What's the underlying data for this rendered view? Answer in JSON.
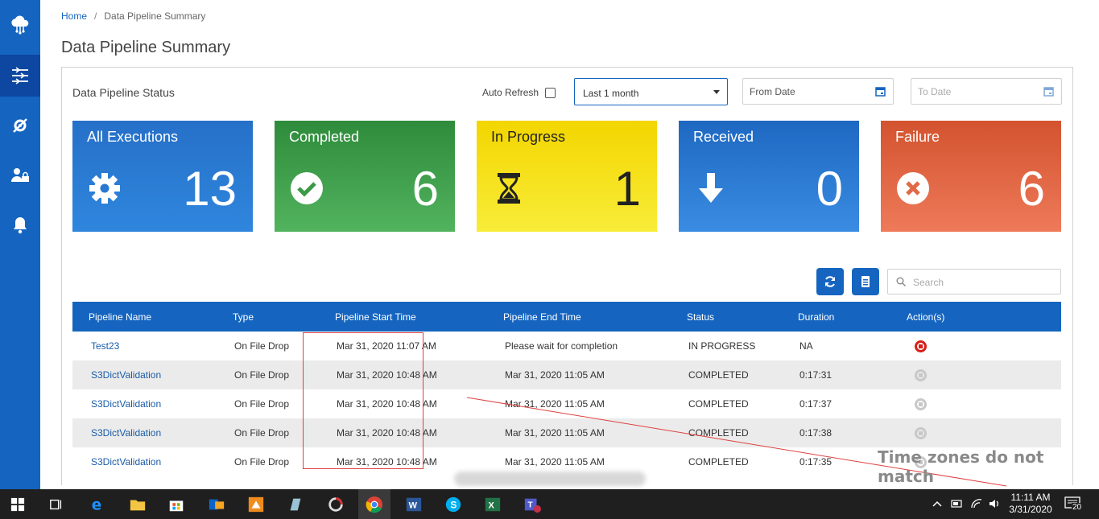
{
  "breadcrumb": {
    "home": "Home",
    "separator": "/",
    "current": "Data Pipeline Summary"
  },
  "page_title": "Data Pipeline Summary",
  "panel": {
    "title": "Data Pipeline Status",
    "auto_refresh_label": "Auto Refresh",
    "auto_refresh_checked": false,
    "range_selected": "Last 1 month",
    "from_date_placeholder": "From Date",
    "to_date_placeholder": "To Date"
  },
  "cards": {
    "all": {
      "label": "All Executions",
      "value": "13",
      "icon": "gear-icon"
    },
    "completed": {
      "label": "Completed",
      "value": "6",
      "icon": "check-circle-icon"
    },
    "in_progress": {
      "label": "In Progress",
      "value": "1",
      "icon": "hourglass-icon"
    },
    "received": {
      "label": "Received",
      "value": "0",
      "icon": "arrow-down-icon"
    },
    "failure": {
      "label": "Failure",
      "value": "6",
      "icon": "x-circle-icon"
    }
  },
  "search_placeholder": "Search",
  "table": {
    "headers": [
      "Pipeline Name",
      "Type",
      "Pipeline Start Time",
      "Pipeline End Time",
      "Status",
      "Duration",
      "Action(s)"
    ],
    "rows": [
      {
        "name": "Test23",
        "type": "On File Drop",
        "start": "Mar 31, 2020 11:07 AM",
        "end": "Please wait for completion",
        "status": "IN PROGRESS",
        "duration": "NA",
        "action": "stop"
      },
      {
        "name": "S3DictValidation",
        "type": "On File Drop",
        "start": "Mar 31, 2020 10:48 AM",
        "end": "Mar 31, 2020 11:05 AM",
        "status": "COMPLETED",
        "duration": "0:17:31",
        "action": "disabled"
      },
      {
        "name": "S3DictValidation",
        "type": "On File Drop",
        "start": "Mar 31, 2020 10:48 AM",
        "end": "Mar 31, 2020 11:05 AM",
        "status": "COMPLETED",
        "duration": "0:17:37",
        "action": "disabled"
      },
      {
        "name": "S3DictValidation",
        "type": "On File Drop",
        "start": "Mar 31, 2020 10:48 AM",
        "end": "Mar 31, 2020 11:05 AM",
        "status": "COMPLETED",
        "duration": "0:17:38",
        "action": "disabled"
      },
      {
        "name": "S3DictValidation",
        "type": "On File Drop",
        "start": "Mar 31, 2020 10:48 AM",
        "end": "Mar 31, 2020 11:05 AM",
        "status": "COMPLETED",
        "duration": "0:17:35",
        "action": "disabled"
      }
    ]
  },
  "annotation": "Time zones do not match",
  "taskbar": {
    "time": "11:11 AM",
    "date": "3/31/2020",
    "notifications": "20"
  },
  "colors": {
    "primary": "#1565c0",
    "all": "#2670c8",
    "completed": "#2e8b3b",
    "in_progress": "#f3d600",
    "received": "#1e68c2",
    "failure": "#d3532f"
  }
}
